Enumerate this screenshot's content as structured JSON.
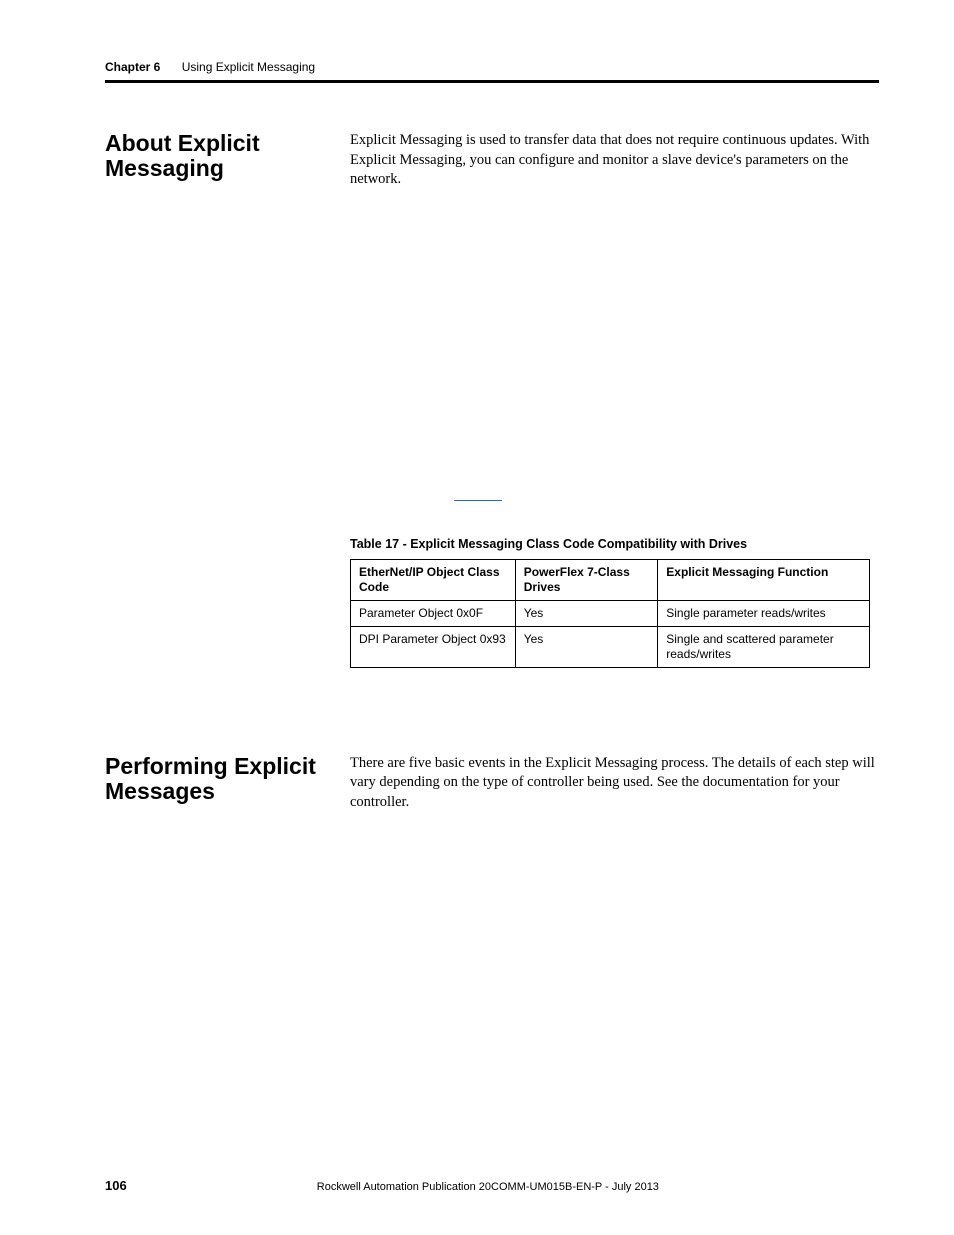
{
  "header": {
    "chapter_label": "Chapter 6",
    "chapter_title": "Using Explicit Messaging"
  },
  "section1": {
    "heading": "About Explicit Messaging",
    "paragraph": "Explicit Messaging is used to transfer data that does not require continuous updates. With Explicit Messaging, you can configure and monitor a slave device's parameters on the network."
  },
  "table": {
    "caption": "Table 17 - Explicit Messaging Class Code Compatibility with Drives",
    "headers": [
      "EtherNet/IP Object Class Code",
      "PowerFlex 7-Class Drives",
      "Explicit Messaging Function"
    ],
    "rows": [
      [
        "Parameter Object 0x0F",
        "Yes",
        "Single parameter reads/writes"
      ],
      [
        "DPI Parameter Object 0x93",
        "Yes",
        "Single and scattered parameter reads/writes"
      ]
    ]
  },
  "section2": {
    "heading": "Performing Explicit Messages",
    "paragraph": "There are five basic events in the Explicit Messaging process. The details of each step will vary depending on the type of controller being used. See the documentation for your controller."
  },
  "footer": {
    "page_number": "106",
    "publication": "Rockwell Automation Publication 20COMM-UM015B-EN-P - July 2013"
  }
}
